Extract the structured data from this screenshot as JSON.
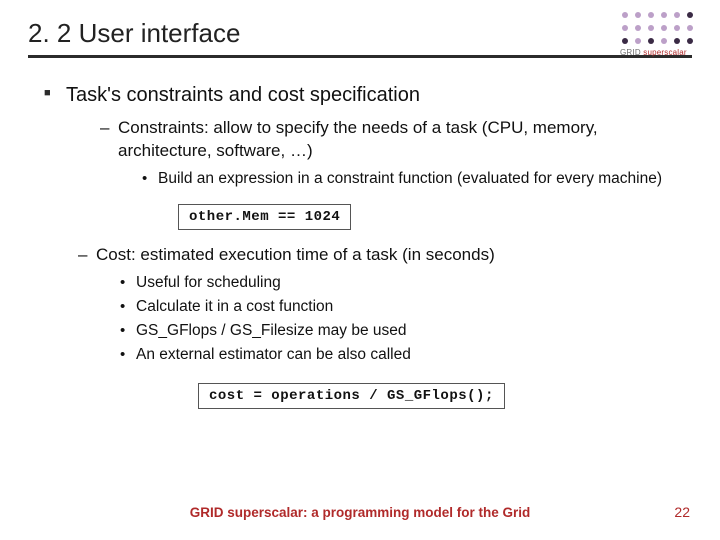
{
  "title": "2. 2 User interface",
  "logo": {
    "line1": "GRID",
    "line2": "superscalar"
  },
  "main": {
    "heading": "Task's constraints and cost specification",
    "constraints": {
      "label": "Constraints: allow to specify the needs of a task (CPU, memory, architecture, software, …)",
      "sub1": "Build an expression in a constraint function (evaluated for every machine)",
      "code": "other.Mem == 1024"
    },
    "cost": {
      "label": "Cost: estimated execution time of a task (in seconds)",
      "items": [
        "Useful for scheduling",
        "Calculate it in a cost function",
        "GS_GFlops / GS_Filesize may be used",
        "An external estimator can be also called"
      ],
      "code": "cost = operations / GS_GFlops();"
    }
  },
  "footer": "GRID superscalar: a programming model for the Grid",
  "page": "22"
}
